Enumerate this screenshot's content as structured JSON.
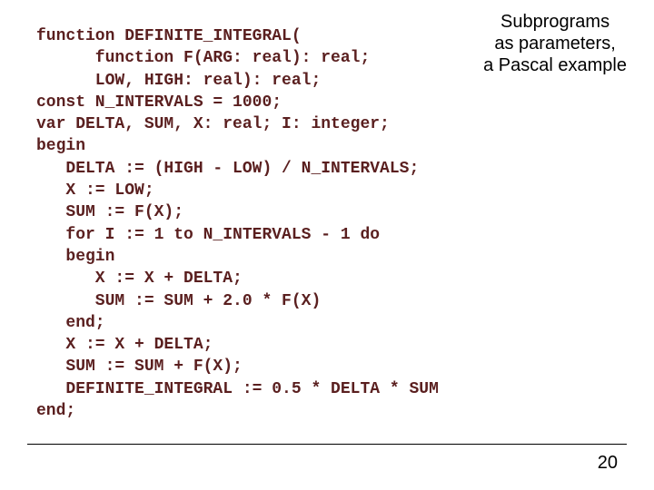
{
  "title": {
    "line1": "Subprograms",
    "line2": "as parameters,",
    "line3": "a Pascal example"
  },
  "code": {
    "l1": "function DEFINITE_INTEGRAL(",
    "l2": "      function F(ARG: real): real;",
    "l3": "      LOW, HIGH: real): real;",
    "l4": "const N_INTERVALS = 1000;",
    "l5": "var DELTA, SUM, X: real; I: integer;",
    "l6": "begin",
    "l7": "   DELTA := (HIGH - LOW) / N_INTERVALS;",
    "l8": "   X := LOW;",
    "l9": "   SUM := F(X);",
    "l10": "   for I := 1 to N_INTERVALS - 1 do",
    "l11": "   begin",
    "l12": "      X := X + DELTA;",
    "l13": "      SUM := SUM + 2.0 * F(X)",
    "l14": "   end;",
    "l15": "   X := X + DELTA;",
    "l16": "   SUM := SUM + F(X);",
    "l17": "   DEFINITE_INTEGRAL := 0.5 * DELTA * SUM",
    "l18": "end;"
  },
  "page_number": "20"
}
